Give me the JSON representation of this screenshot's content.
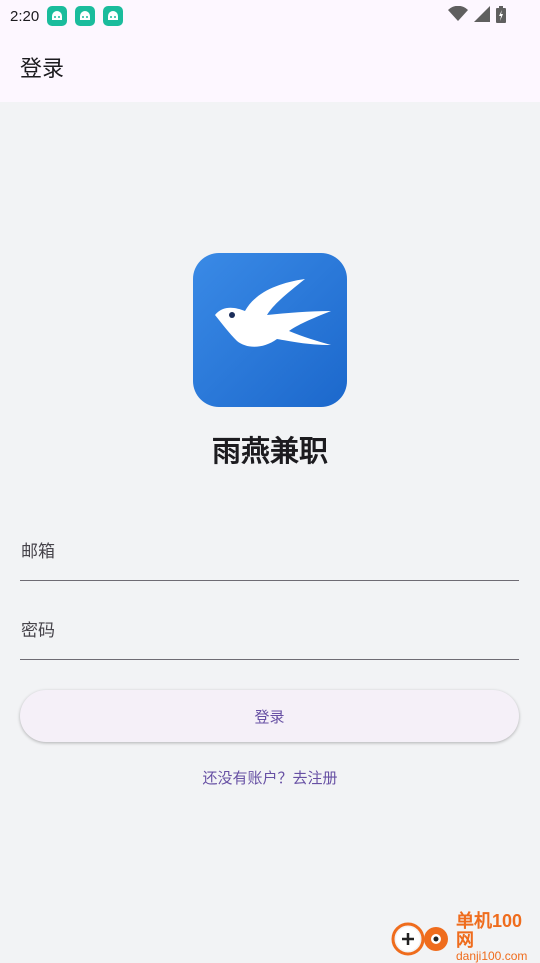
{
  "status_bar": {
    "time": "2:20",
    "notification_icons": [
      "android-notification-icon",
      "android-notification-icon",
      "android-notification-icon"
    ],
    "notification_color": "#1abc9c"
  },
  "app_bar": {
    "title": "登录"
  },
  "brand": {
    "app_name": "雨燕兼职",
    "logo_icon": "swallow-bird-icon",
    "logo_color": "#2b7de0"
  },
  "form": {
    "email_label": "邮箱",
    "password_label": "密码",
    "login_button": "登录",
    "register_link": "还没有账户？去注册"
  },
  "watermark": {
    "main": "单机100网",
    "sub": "danji100.com"
  },
  "colors": {
    "accent": "#6750a4",
    "background": "#f2f3f5",
    "app_bar": "#fdf7ff"
  }
}
